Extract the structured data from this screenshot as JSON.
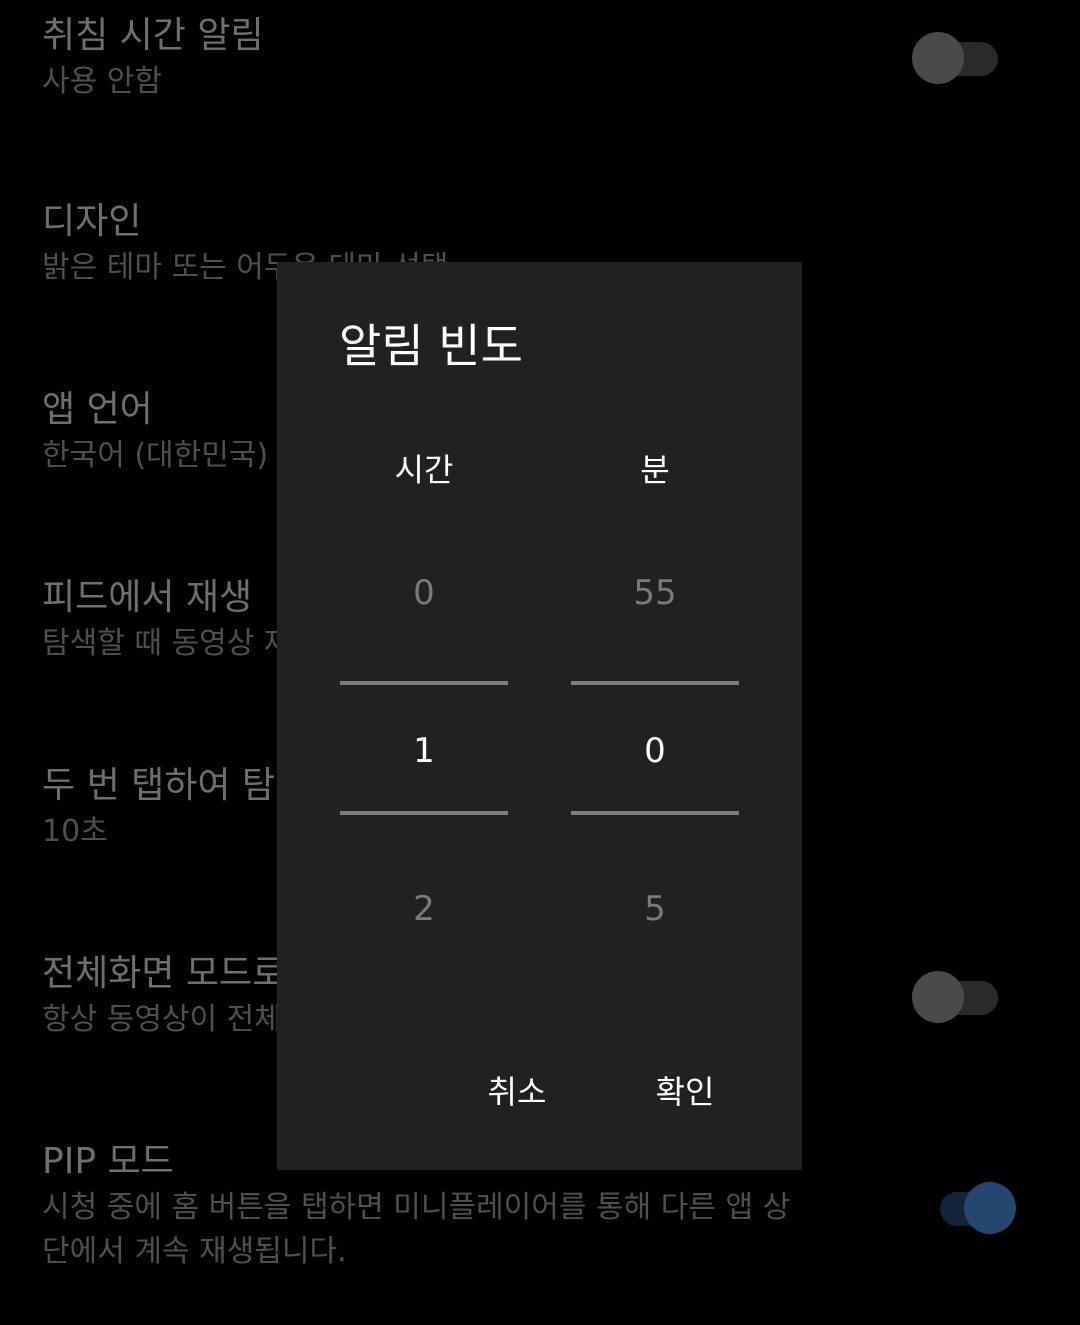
{
  "settings": {
    "items": [
      {
        "title": "취침 시간 알림",
        "subtitle": "사용 안함",
        "toggle": "off"
      },
      {
        "title": "디자인",
        "subtitle": "밝은 테마 또는 어두운 테마 선택"
      },
      {
        "title": "앱 언어",
        "subtitle": "한국어 (대한민국)"
      },
      {
        "title": "피드에서 재생",
        "subtitle": "탐색할 때 동영상 재생"
      },
      {
        "title": "두 번 탭하여 탐색",
        "subtitle": "10초"
      },
      {
        "title": "전체화면 모드로 보기",
        "subtitle": "항상 동영상이 전체화면으로 재생됩니다",
        "toggle": "off"
      },
      {
        "title": "PIP 모드",
        "subtitle": "시청 중에 홈 버튼을 탭하면 미니플레이어를 통해 다른 앱 상단에서 계속 재생됩니다.",
        "toggle": "on"
      }
    ]
  },
  "dialog": {
    "title": "알림 빈도",
    "hours": {
      "label": "시간",
      "prev": "0",
      "selected": "1",
      "next": "2"
    },
    "minutes": {
      "label": "분",
      "prev": "55",
      "selected": "0",
      "next": "5"
    },
    "cancel_label": "취소",
    "ok_label": "확인"
  },
  "colors": {
    "background": "#000000",
    "dialog": "#212121",
    "toggle_on": "#25466e"
  }
}
